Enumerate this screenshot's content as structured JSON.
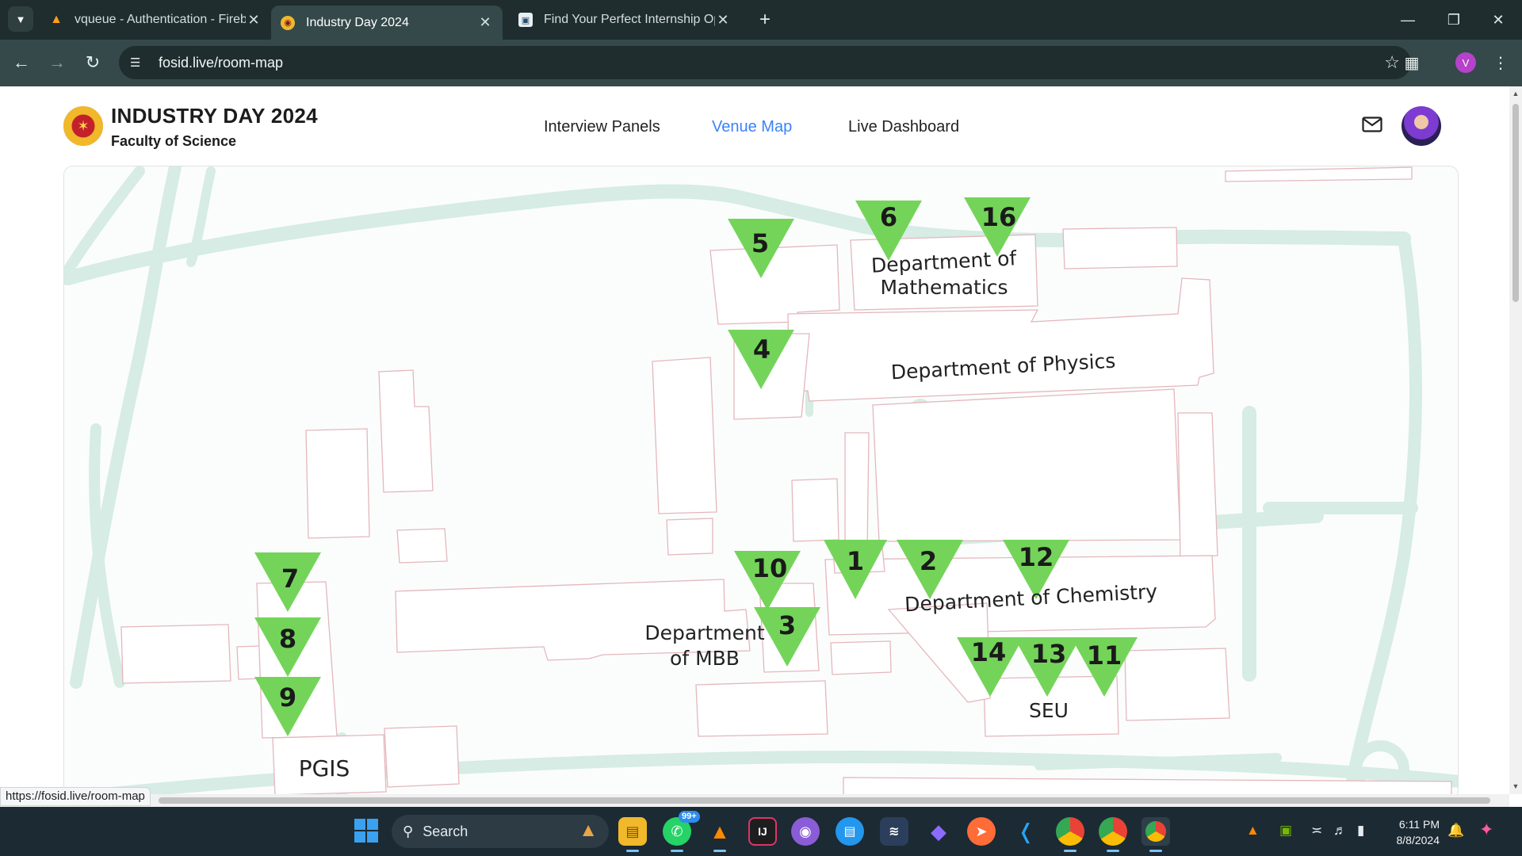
{
  "browser": {
    "tabs": [
      {
        "title": "vqueue - Authentication - Fireb",
        "favicon": "firebase-icon",
        "active": false
      },
      {
        "title": "Industry Day 2024",
        "favicon": "university-logo-icon",
        "active": true
      },
      {
        "title": "Find Your Perfect Internship Op",
        "favicon": "internship-site-icon",
        "active": false
      }
    ],
    "url": "fosid.live/room-map",
    "profile_initial": "V",
    "status_url": "https://fosid.live/room-map"
  },
  "site": {
    "title": "INDUSTRY DAY 2024",
    "subtitle": "Faculty of Science",
    "nav": [
      {
        "label": "Interview Panels",
        "active": false
      },
      {
        "label": "Venue Map",
        "active": true
      },
      {
        "label": "Live Dashboard",
        "active": false
      }
    ],
    "accent_color": "#3b82f6"
  },
  "map": {
    "marker_color": "#74d45a",
    "markers": [
      "1",
      "2",
      "3",
      "4",
      "5",
      "6",
      "7",
      "8",
      "9",
      "10",
      "11",
      "12",
      "13",
      "14",
      "16"
    ],
    "labels": {
      "mathematics_line1": "Department of",
      "mathematics_line2": "Mathematics",
      "physics": "Department of Physics",
      "chemistry": "Department of Chemistry",
      "mbb_line1": "Department",
      "mbb_line2": "of MBB",
      "seu": "SEU",
      "pgis": "PGIS"
    }
  },
  "taskbar": {
    "search_label": "Search",
    "whatsapp_badge": "99+",
    "time": "6:11 PM",
    "date": "8/8/2024"
  }
}
